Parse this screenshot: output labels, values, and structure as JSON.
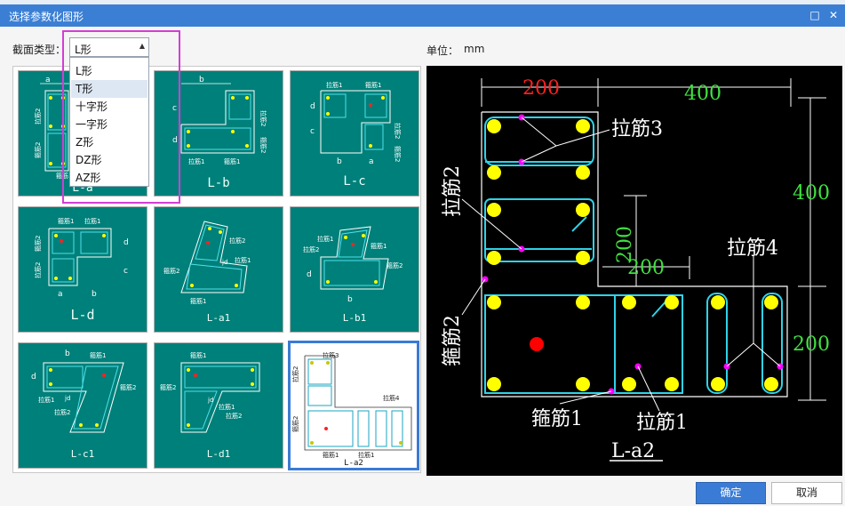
{
  "window": {
    "title": "选择参数化图形"
  },
  "form": {
    "section_type_label": "截面类型：",
    "section_type_value": "L形",
    "unit_label": "单位：",
    "unit_value": "mm"
  },
  "dropdown": {
    "options": [
      "L形",
      "T形",
      "十字形",
      "一字形",
      "Z形",
      "DZ形",
      "AZ形"
    ],
    "hovered_index": 1
  },
  "thumbnails": [
    {
      "caption": "L-a",
      "labels": [
        "a",
        "拉筋2",
        "箍筋2",
        "箍筋1"
      ]
    },
    {
      "caption": "L-b",
      "labels": [
        "b",
        "c",
        "d",
        "拉筋2",
        "箍筋2",
        "拉筋1",
        "箍筋1"
      ]
    },
    {
      "caption": "L-c",
      "labels": [
        "拉筋1",
        "箍筋1",
        "c",
        "d",
        "拉筋2",
        "箍筋2",
        "b",
        "a"
      ]
    },
    {
      "caption": "L-d",
      "labels": [
        "箍筋1",
        "拉筋1",
        "拉筋2",
        "箍筋2",
        "c",
        "d",
        "a",
        "b"
      ]
    },
    {
      "caption": "L-a1",
      "labels": [
        "拉筋2",
        "jd",
        "拉筋1",
        "箍筋2",
        "箍筋1"
      ]
    },
    {
      "caption": "L-b1",
      "labels": [
        "拉筋2",
        "拉筋1",
        "箍筋1",
        "箍筋2",
        "b",
        "d"
      ]
    },
    {
      "caption": "L-c1",
      "labels": [
        "b",
        "箍筋1",
        "d",
        "箍筋2",
        "拉筋1",
        "jd",
        "拉筋2"
      ]
    },
    {
      "caption": "L-d1",
      "labels": [
        "箍筋1",
        "箍筋2",
        "jd",
        "拉筋1",
        "拉筋2"
      ]
    },
    {
      "caption": "L-a2",
      "labels": [
        "拉筋3",
        "拉筋2",
        "箍筋2",
        "拉筋4",
        "箍筋1",
        "拉筋1"
      ]
    }
  ],
  "selected_thumbnail_index": 8,
  "preview": {
    "caption": "L-a2",
    "dimensions": [
      "200",
      "400",
      "400",
      "200",
      "200",
      "200"
    ],
    "labels": [
      "拉筋3",
      "拉筋2",
      "箍筋2",
      "拉筋4",
      "箍筋1",
      "拉筋1"
    ],
    "colors": {
      "background": "#000000",
      "section": "#ffffff",
      "stirrup": "#2fd3e8",
      "bar": "#ffff00",
      "center": "#ff0000",
      "dimension_main": "#ff2020",
      "dimension_other": "#40e040",
      "tie_point": "#ff00ff"
    }
  },
  "buttons": {
    "ok": "确定",
    "cancel": "取消"
  },
  "title_icons": [
    "maximize-icon",
    "close-icon"
  ]
}
